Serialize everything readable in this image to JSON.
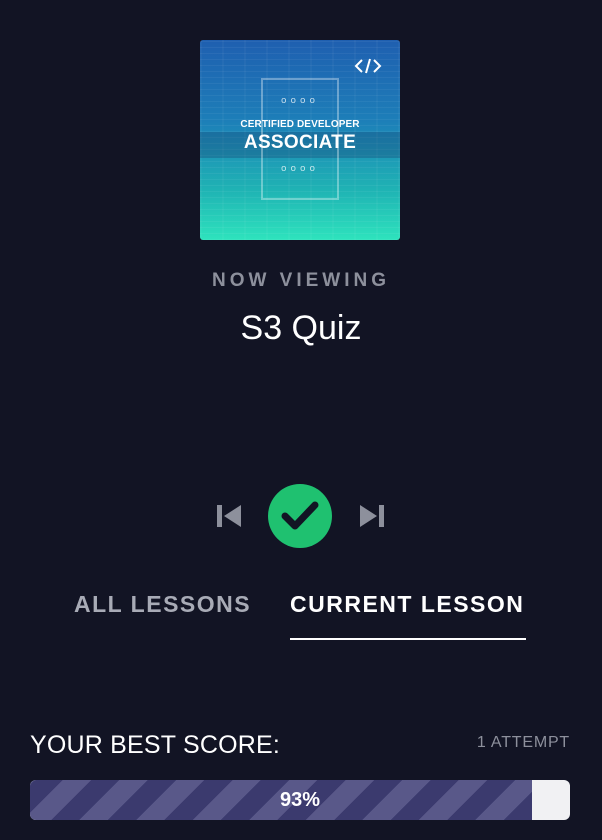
{
  "course": {
    "thumbnail_line1": "CERTIFIED DEVELOPER",
    "thumbnail_line2": "ASSOCIATE",
    "thumbnail_dots": "oooo",
    "thumbnail_icon": "code-icon"
  },
  "now_viewing_label": "NOW VIEWING",
  "lesson_title": "S3 Quiz",
  "controls": {
    "prev_icon": "skip-previous-icon",
    "complete_icon": "checkmark-icon",
    "next_icon": "skip-next-icon",
    "complete_color": "#1fc170"
  },
  "tabs": [
    {
      "label": "ALL LESSONS",
      "active": false
    },
    {
      "label": "CURRENT LESSON",
      "active": true
    }
  ],
  "score": {
    "label": "YOUR BEST SCORE:",
    "attempts": "1 ATTEMPT",
    "percent_text": "93%",
    "percent_value": 93
  },
  "colors": {
    "background": "#121424",
    "progress_fill": "#3b3a6e",
    "progress_stripe": "#595889",
    "progress_track": "#f1f1f3"
  }
}
